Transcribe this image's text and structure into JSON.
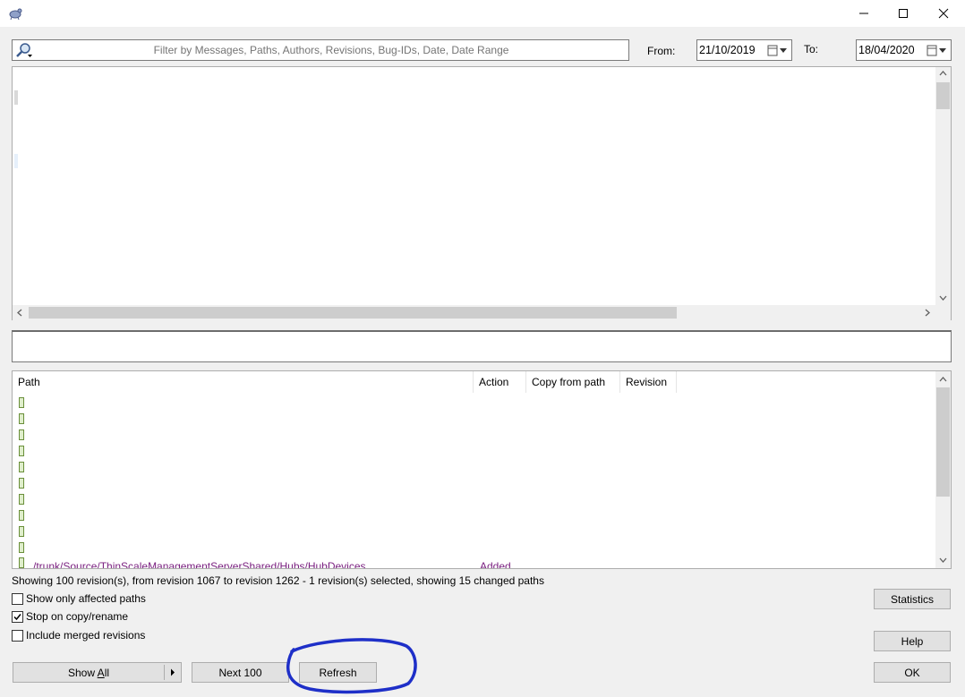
{
  "window": {
    "app_icon": "tortoise-icon",
    "minimize_icon": "minimize-icon",
    "maximize_icon": "maximize-icon",
    "close_icon": "close-icon"
  },
  "filter": {
    "placeholder": "Filter by Messages, Paths, Authors, Revisions, Bug-IDs, Date, Date Range",
    "icon": "search-icon"
  },
  "date_range": {
    "from_label": "From:",
    "from_value": "21/10/2019",
    "to_label": "To:",
    "to_value": "18/04/2020"
  },
  "changed_paths": {
    "columns": [
      "Path",
      "Action",
      "Copy from path",
      "Revision"
    ],
    "partial_row": {
      "path": "/trunk/Source/ThinScaleManagementServerShared/Hubs/HubDevices",
      "action": "Added"
    }
  },
  "status": {
    "text": "Showing 100 revision(s), from revision 1067 to revision 1262 - 1 revision(s) selected, showing 15 changed paths"
  },
  "options": {
    "show_only_affected_paths": {
      "label": "Show only affected paths",
      "checked": false
    },
    "stop_on_copy_rename": {
      "label": "Stop on copy/rename",
      "checked": true
    },
    "include_merged_revisions": {
      "label": "Include merged revisions",
      "checked": false
    }
  },
  "buttons": {
    "statistics": "Statistics",
    "help": "Help",
    "show_all": "Show All",
    "show_all_access": "A",
    "show_all_prefix": "Show ",
    "show_all_suffix": "ll",
    "next_100": "Next 100",
    "refresh": "Refresh",
    "ok": "OK"
  },
  "colors": {
    "annotation_circle": "#1e2fc8",
    "window_bg": "#f0f0f0"
  }
}
